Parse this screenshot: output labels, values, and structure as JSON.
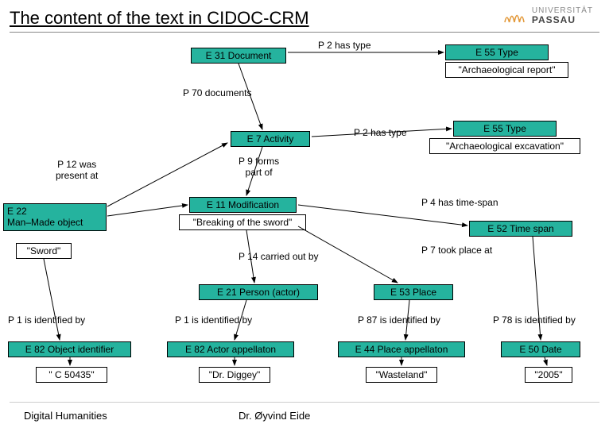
{
  "title": "The content of the text in CIDOC-CRM",
  "logo": {
    "uni": "UNIVERSITÄT",
    "city": "PASSAU"
  },
  "nodes": {
    "e31": "E 31 Document",
    "e55a": "E 55 Type",
    "archReport": "\"Archaeological report\"",
    "e7": "E 7 Activity",
    "e55b": "E 55 Type",
    "archExcav": "\"Archaeological excavation\"",
    "e22_1": "E 22",
    "e22_2": "Man–Made object",
    "e11": "E 11 Modification",
    "breaking": "\"Breaking of the sword\"",
    "sword": "\"Sword\"",
    "e52": "E 52 Time span",
    "e21": "E 21 Person (actor)",
    "e53": "E 53 Place",
    "e82obj": "E 82 Object identifier",
    "e82act": "E 82 Actor appellaton",
    "e44": "E 44 Place appellaton",
    "e50": "E 50 Date",
    "c50435": "\" C 50435\"",
    "drdiggey": "\"Dr. Diggey\"",
    "wasteland": "\"Wasteland\"",
    "y2005": "\"2005\""
  },
  "labels": {
    "p2a": "P 2 has type",
    "p70": "P 70 documents",
    "p2b": "P 2 has type",
    "p12": "P 12 was\npresent at",
    "p9": "P 9 forms\npart of",
    "p4": "P 4 has time-span",
    "p14": "P 14 carried out by",
    "p7": "P 7 took place at",
    "p1a": "P 1 is identified by",
    "p1b": "P 1 is identified by",
    "p87": "P 87 is identified by",
    "p78": "P 78 is identified by"
  },
  "footer": {
    "left": "Digital Humanities",
    "mid": "Dr. Øyvind Eide"
  }
}
